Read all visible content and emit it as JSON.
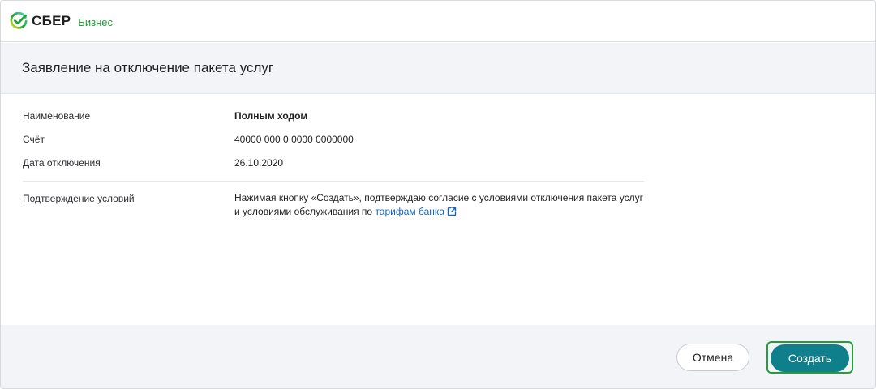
{
  "header": {
    "brand": "СБЕР",
    "product": "Бизнес",
    "logo_icon": "sber-logo-icon"
  },
  "page": {
    "title": "Заявление на отключение пакета услуг"
  },
  "details": {
    "name_label": "Наименование",
    "name_value": "Полным ходом",
    "account_label": "Счёт",
    "account_value": "40000 000 0 0000 0000000",
    "date_label": "Дата отключения",
    "date_value": "26.10.2020"
  },
  "confirmation": {
    "label": "Подтверждение условий",
    "text_before_link": "Нажимая кнопку «Создать», подтверждаю согласие с условиями отключения пакета услуг и условиями обслуживания по ",
    "link_text": "тарифам банка",
    "link_icon": "external-link-icon"
  },
  "actions": {
    "cancel_label": "Отмена",
    "create_label": "Создать"
  },
  "colors": {
    "brand_green": "#21a038",
    "primary_button": "#107f8c",
    "link": "#1565c0"
  }
}
